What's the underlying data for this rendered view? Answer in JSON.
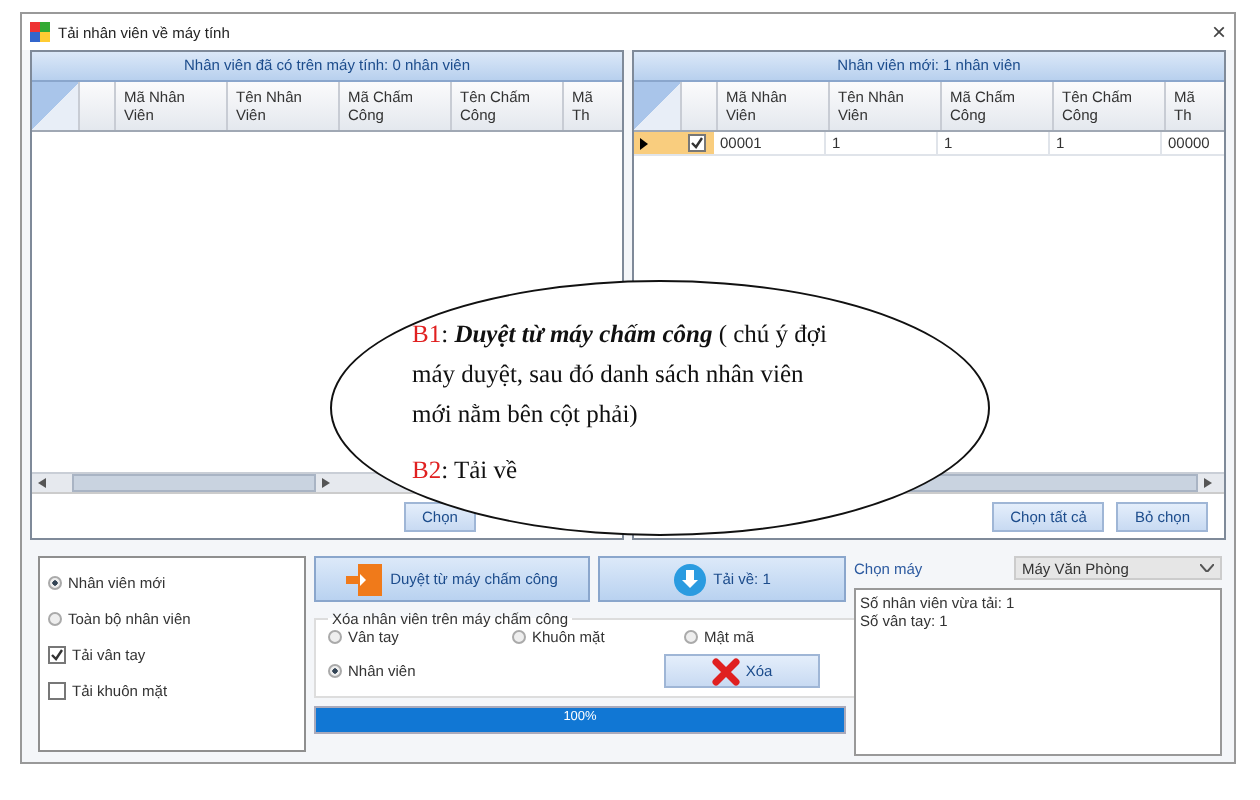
{
  "window": {
    "title": "Tải nhân viên về máy tính",
    "close": "×"
  },
  "left_grid": {
    "caption": "Nhân viên đã có trên máy tính: 0 nhân viên",
    "columns": [
      "Mã Nhân Viên",
      "Tên Nhân Viên",
      "Mã Chấm Công",
      "Tên Chấm Công",
      "Mã Th"
    ],
    "buttons": [
      "Chọn"
    ]
  },
  "right_grid": {
    "caption": "Nhân viên mới: 1 nhân viên",
    "columns": [
      "Mã Nhân Viên",
      "Tên Nhân Viên",
      "Mã Chấm Công",
      "Tên Chấm Công",
      "Mã Th"
    ],
    "rows": [
      {
        "selected": true,
        "checked": true,
        "cells": [
          "00001",
          "1",
          "1",
          "1",
          "00000"
        ]
      }
    ],
    "buttons": [
      "Chọn tất cả",
      "Bỏ chọn"
    ]
  },
  "options": [
    {
      "kind": "radio",
      "label": "Nhân viên mới",
      "checked": true
    },
    {
      "kind": "radio",
      "label": "Toàn bộ nhân viên",
      "checked": false
    },
    {
      "kind": "checkbox",
      "label": "Tải vân tay",
      "checked": true
    },
    {
      "kind": "checkbox",
      "label": "Tải khuôn mặt",
      "checked": false
    }
  ],
  "actions": {
    "browse_button": "Duyệt từ máy chấm công",
    "download_button": "Tải về: 1"
  },
  "delete_group": {
    "title": "Xóa nhân viên trên máy chấm công",
    "options": [
      {
        "label": "Vân tay",
        "selected": false
      },
      {
        "label": "Khuôn mặt",
        "selected": false
      },
      {
        "label": "Mật mã",
        "selected": false
      },
      {
        "label": "Nhân viên",
        "selected": true
      }
    ],
    "button": "Xóa"
  },
  "progress": {
    "level": 1,
    "label": "100%"
  },
  "machine": {
    "label": "Chọn máy",
    "value": "Máy Văn Phòng"
  },
  "log": [
    "Số nhân viên vừa tải: 1",
    "Số vân tay: 1"
  ],
  "callout": {
    "steps": [
      {
        "marker": "B1",
        "text": ": **Duyệt từ máy chấm công** ( chú ý đợi máy duyệt, sau đó danh sách nhân viên mới nằm bên cột phải)"
      },
      {
        "marker": "B2",
        "text": ": Tải về"
      }
    ]
  }
}
